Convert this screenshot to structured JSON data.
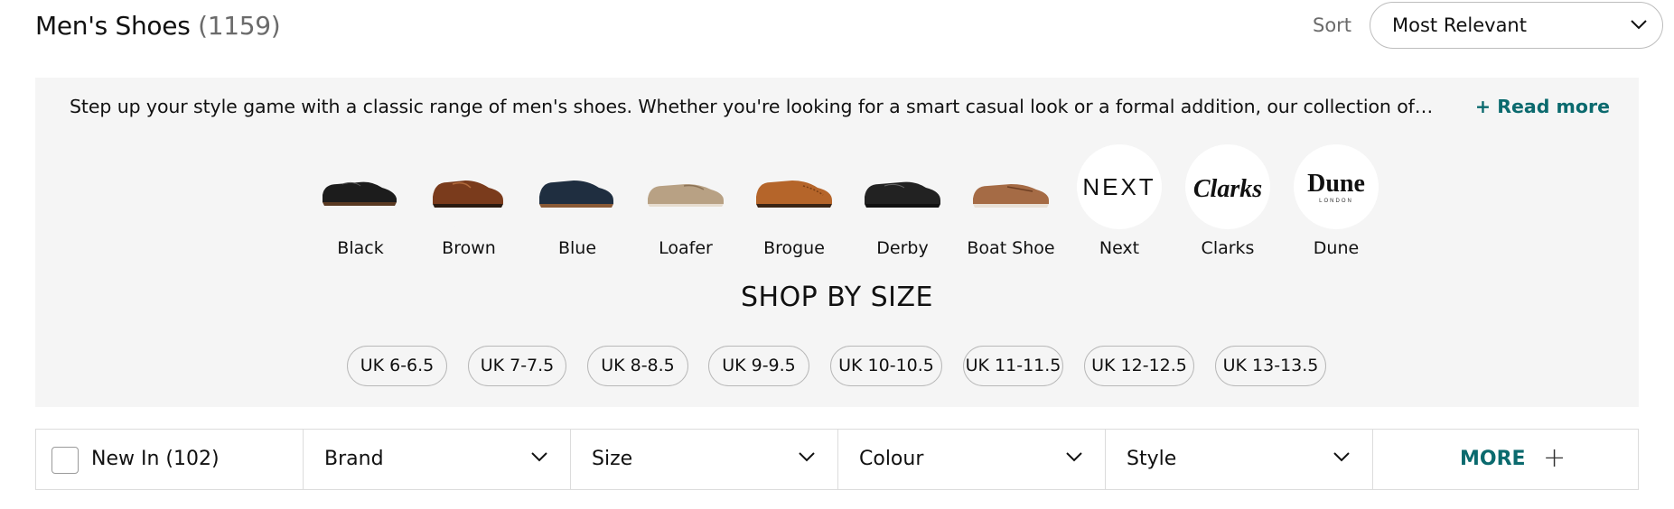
{
  "header": {
    "title": "Men's Shoes",
    "count": "(1159)",
    "sort_label": "Sort",
    "sort_value": "Most Relevant"
  },
  "intro": {
    "description": "Step up your style game with a classic range of men's shoes. Whether you're looking for a smart casual look or a formal addition, our collection of…",
    "read_more": "+ Read more"
  },
  "categories": [
    {
      "label": "Black",
      "icon": "black-shoe-icon",
      "color": "#1c1c1c"
    },
    {
      "label": "Brown",
      "icon": "brown-shoe-icon",
      "color": "#7a3b1c"
    },
    {
      "label": "Blue",
      "icon": "blue-shoe-icon",
      "color": "#1f2e40"
    },
    {
      "label": "Loafer",
      "icon": "loafer-shoe-icon",
      "color": "#b8a184"
    },
    {
      "label": "Brogue",
      "icon": "brogue-shoe-icon",
      "color": "#b5652a"
    },
    {
      "label": "Derby",
      "icon": "derby-shoe-icon",
      "color": "#222222"
    },
    {
      "label": "Boat Shoe",
      "icon": "boat-shoe-icon",
      "color": "#a56b45"
    },
    {
      "label": "Next",
      "icon": "next-logo",
      "logo_text": "NEXT"
    },
    {
      "label": "Clarks",
      "icon": "clarks-logo",
      "logo_text": "Clarks"
    },
    {
      "label": "Dune",
      "icon": "dune-logo",
      "logo_text": "Dune",
      "logo_sub": "LONDON"
    }
  ],
  "sizes": {
    "heading": "SHOP BY SIZE",
    "chips": [
      "UK 6-6.5",
      "UK 7-7.5",
      "UK 8-8.5",
      "UK 9-9.5",
      "UK 10-10.5",
      "UK 11-11.5",
      "UK 12-12.5",
      "UK 13-13.5"
    ]
  },
  "filters": {
    "new_in": "New In (102)",
    "brand": "Brand",
    "size": "Size",
    "colour": "Colour",
    "style": "Style",
    "more": "MORE"
  },
  "colors": {
    "accent": "#0b6a6e",
    "panel_bg": "#f5f5f5",
    "border": "#dcdcdc"
  }
}
